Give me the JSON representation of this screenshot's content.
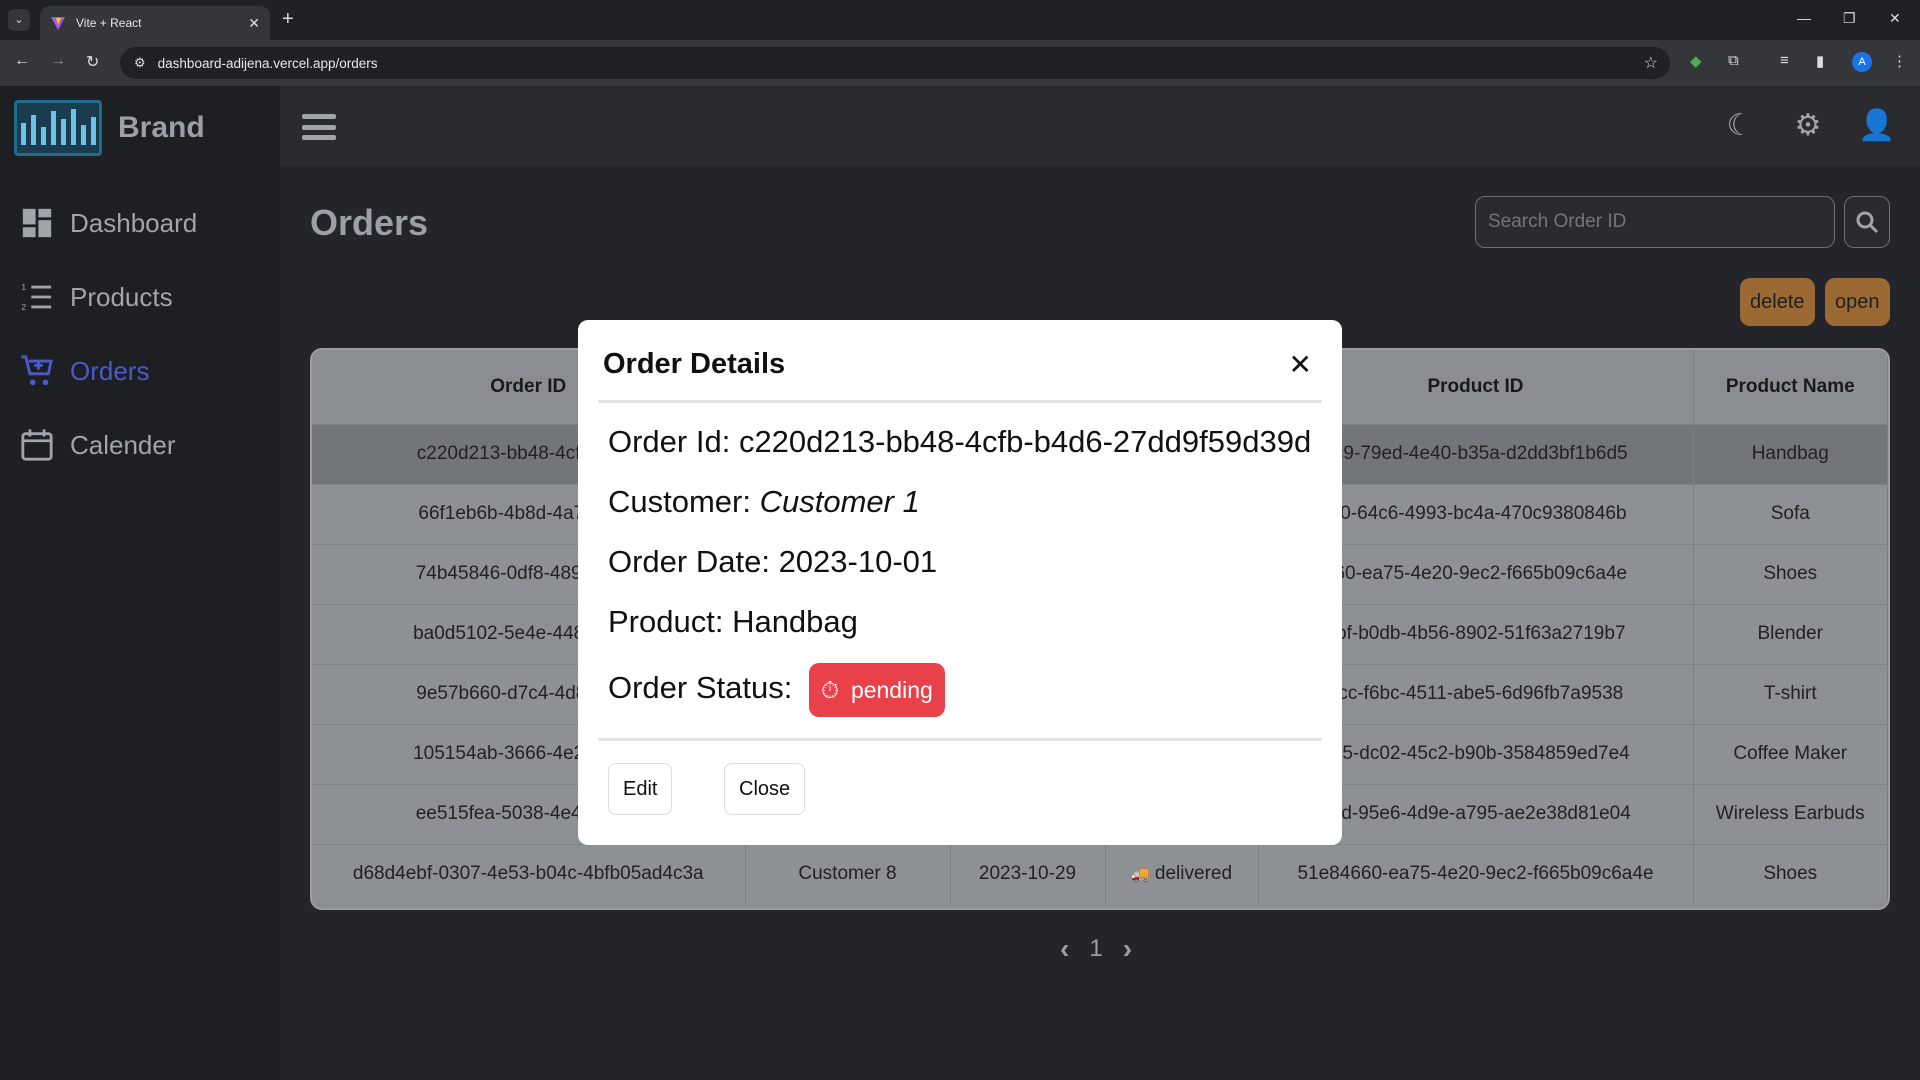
{
  "browser": {
    "tab_title": "Vite + React",
    "url": "dashboard-adijena.vercel.app/orders",
    "profile_initial": "A"
  },
  "app": {
    "brand": "Brand",
    "nav": [
      {
        "label": "Dashboard",
        "icon": "dashboard-icon",
        "active": false
      },
      {
        "label": "Products",
        "icon": "list-icon",
        "active": false
      },
      {
        "label": "Orders",
        "icon": "cart-icon",
        "active": true
      },
      {
        "label": "Calender",
        "icon": "calendar-icon",
        "active": false
      }
    ],
    "accent_color": "#4a5ac9"
  },
  "page": {
    "title": "Orders",
    "search_placeholder": "Search Order ID",
    "delete_label": "delete",
    "open_label": "open"
  },
  "table": {
    "headers": [
      "Order ID",
      "Customer",
      "Order Date",
      "Status",
      "Product ID",
      "Product Name"
    ],
    "rows": [
      [
        "c220d213-bb48-4cfb-b4d6-27dd9f59d39d",
        "Customer 1",
        "2023-10-01",
        "pending",
        "...dc9-79ed-4e40-b35a-d2dd3bf1b6d5",
        "Handbag"
      ],
      [
        "66f1eb6b-4b8d-4a7f-ba59",
        "",
        "",
        "",
        "...af0-64c6-4993-bc4a-470c9380846b",
        "Sofa"
      ],
      [
        "74b45846-0df8-4898-8ad4",
        "",
        "",
        "",
        "...660-ea75-4e20-9ec2-f665b09c6a4e",
        "Shoes"
      ],
      [
        "ba0d5102-5e4e-4489-b889",
        "",
        "",
        "",
        "...0bf-b0db-4b56-8902-51f63a2719b7",
        "Blender"
      ],
      [
        "9e57b660-d7c4-4d86-aedf",
        "",
        "",
        "",
        "...8cc-f6bc-4511-abe5-6d96fb7a9538",
        "T-shirt"
      ],
      [
        "105154ab-3666-4e2a-a343",
        "",
        "",
        "",
        "...b15-dc02-45c2-b90b-3584859ed7e4",
        "Coffee Maker"
      ],
      [
        "ee515fea-5038-4e4c-af0a",
        "",
        "",
        "",
        "...5ad-95e6-4d9e-a795-ae2e38d81e04",
        "Wireless Earbuds"
      ],
      [
        "d68d4ebf-0307-4e53-b04c-4bfb05ad4c3a",
        "Customer 8",
        "2023-10-29",
        "delivered",
        "51e84660-ea75-4e20-9ec2-f665b09c6a4e",
        "Shoes"
      ]
    ],
    "visible_cells": {
      "r1c1": "c220d213-bb48-4cfb-b4d6",
      "r1c5": "dc9-79ed-4e40-b35a-d2dd3bf1b6d5",
      "r2c1": "66f1eb6b-4b8d-4a7f-ba59",
      "r2c5": "af0-64c6-4993-bc4a-470c9380846b",
      "r3c1": "74b45846-0df8-4898-8ad4",
      "r3c5": "660-ea75-4e20-9ec2-f665b09c6a4e",
      "r4c1": "ba0d5102-5e4e-4489-b889",
      "r4c5": "0bf-b0db-4b56-8902-51f63a2719b7",
      "r5c1": "9e57b660-d7c4-4d86-aedf",
      "r5c5": "8cc-f6bc-4511-abe5-6d96fb7a9538",
      "r6c1": "105154ab-3666-4e2a-a343",
      "r6c5": "b15-dc02-45c2-b90b-3584859ed7e4",
      "r7c1": "ee515fea-5038-4e4c-af0a-",
      "r7c5": "5ad-95e6-4d9e-a795-ae2e38d81e04"
    },
    "page_number": "1"
  },
  "modal": {
    "title": "Order Details",
    "order_id_label": "Order Id: ",
    "order_id": "c220d213-bb48-4cfb-b4d6-27dd9f59d39d",
    "customer_label": "Customer: ",
    "customer": "Customer 1",
    "date_label": "Order Date: ",
    "date": "2023-10-01",
    "product_label": "Product: ",
    "product": "Handbag",
    "status_label": "Order Status:",
    "status": "pending",
    "status_color": "#e8414a",
    "edit_label": "Edit",
    "close_label": "Close"
  }
}
